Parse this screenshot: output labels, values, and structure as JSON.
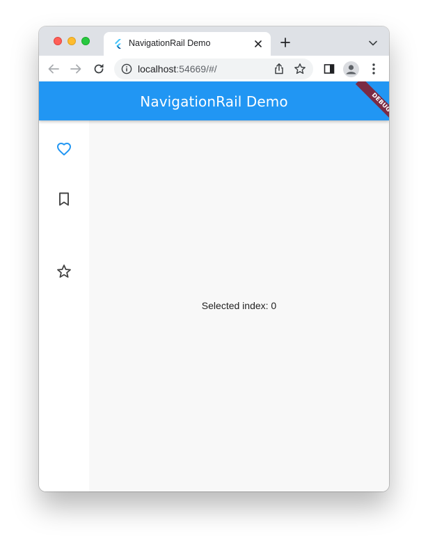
{
  "browser": {
    "tab": {
      "title": "NavigationRail Demo",
      "favicon": "flutter-icon"
    },
    "toolbar": {
      "url_host": "localhost",
      "url_rest": ":54669/#/"
    },
    "icons": {
      "back": "back-arrow-icon",
      "forward": "forward-arrow-icon",
      "reload": "reload-icon",
      "info": "info-icon",
      "share": "share-icon",
      "bookmark": "star-icon",
      "sidepanel": "side-panel-icon",
      "profile": "profile-avatar-icon",
      "menu": "more-vert-icon",
      "newtab": "plus-icon",
      "tabsearch": "chevron-down-icon"
    }
  },
  "app": {
    "appbar_title": "NavigationRail Demo",
    "debug_banner": "DEBUG",
    "rail": {
      "selected_index": 0,
      "accent_color": "#2196f3",
      "items": [
        {
          "icon": "favorite-icon",
          "selected": true
        },
        {
          "icon": "bookmark-icon",
          "selected": false
        },
        {
          "icon": "star-icon",
          "selected": false
        }
      ]
    },
    "content": {
      "selected_text": "Selected index: 0"
    }
  },
  "colors": {
    "appbar": "#2196f3",
    "tabstrip": "#dee1e6",
    "content_bg": "#f8f8f8",
    "debug_ribbon": "#7b2b44"
  }
}
